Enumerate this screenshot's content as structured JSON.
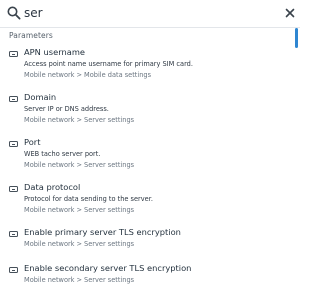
{
  "search": {
    "value": "ser",
    "icon": "search-icon"
  },
  "close": {
    "icon": "close-icon"
  },
  "section": {
    "title": "Parameters"
  },
  "results": [
    {
      "title": "APN username",
      "description": "Access point name username for primary SIM card.",
      "breadcrumb": [
        "Mobile network",
        "Mobile data settings"
      ]
    },
    {
      "title": "Domain",
      "description": "Server IP or DNS address.",
      "breadcrumb": [
        "Mobile network",
        "Server settings"
      ]
    },
    {
      "title": "Port",
      "description": "WEB tacho server port.",
      "breadcrumb": [
        "Mobile network",
        "Server settings"
      ]
    },
    {
      "title": "Data protocol",
      "description": "Protocol for data sending to the server.",
      "breadcrumb": [
        "Mobile network",
        "Server settings"
      ]
    },
    {
      "title": "Enable primary server TLS encryption",
      "description": "",
      "breadcrumb": [
        "Mobile network",
        "Server settings"
      ]
    },
    {
      "title": "Enable secondary server TLS encryption",
      "description": "",
      "breadcrumb": [
        "Mobile network",
        "Server settings"
      ]
    }
  ],
  "breadcrumb_separator": ">",
  "colors": {
    "accent": "#2f86d1",
    "text": "#1f2d3a",
    "muted": "#6a7580"
  }
}
